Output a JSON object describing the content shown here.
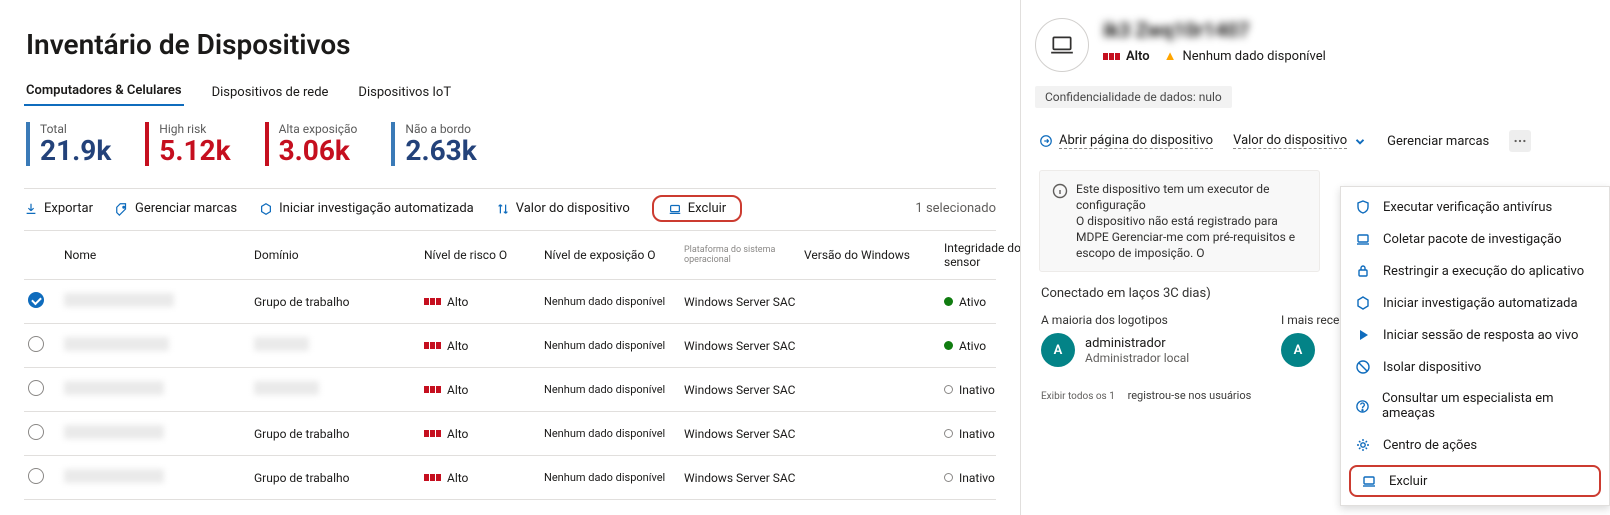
{
  "page": {
    "title": "Inventário de Dispositivos"
  },
  "tabs": [
    {
      "label": "Computadores &amp; Celulares",
      "selected": true
    },
    {
      "label": "Dispositivos de rede"
    },
    {
      "label": "Dispositivos IoT"
    }
  ],
  "stats": {
    "total": {
      "label": "Total",
      "value": "21.9k"
    },
    "high": {
      "label": "High risk",
      "value": "5.12k"
    },
    "exposure": {
      "label": "Alta exposição",
      "value": "3.06k"
    },
    "noboard": {
      "label": "Não a bordo",
      "value": "2.63k"
    }
  },
  "toolbar": {
    "export": "Exportar",
    "manage_tags": "Gerenciar marcas",
    "start_auto": "Iniciar investigação automatizada",
    "device_value": "Valor do dispositivo",
    "exclude": "Excluir",
    "selected": "1 selecionado"
  },
  "columns": {
    "name": "Nome",
    "domain": "Domínio",
    "risk": "Nível de risco O",
    "exposure": "Nível de exposição O",
    "platform": "Plataforma do sistema operacional",
    "winver": "Versão do Windows",
    "sensor": "Integridade do sensor"
  },
  "risk_label": "Alto",
  "exposure_label": "Nenhum dado disponível",
  "rows": [
    {
      "selected": true,
      "name_blur": 110,
      "domain": "Grupo de trabalho",
      "platform": "Windows Server SAC",
      "sensor": "Ativo",
      "active": true
    },
    {
      "selected": false,
      "name_blur": 105,
      "domain_blur": 55,
      "platform": "Windows Server SAC",
      "sensor": "Ativo",
      "active": true
    },
    {
      "selected": false,
      "name_blur": 100,
      "domain_blur": 65,
      "platform": "Windows Server SAC",
      "sensor": "Inativo",
      "active": false
    },
    {
      "selected": false,
      "name_blur": 100,
      "domain": "Grupo de trabalho",
      "platform": "Windows Server SAC",
      "sensor": "Inativo",
      "active": false
    },
    {
      "selected": false,
      "name_blur": 100,
      "domain": "Grupo de trabalho",
      "platform": "Windows Server SAC",
      "sensor": "Inativo",
      "active": false
    }
  ],
  "panel": {
    "name_blur": "ik3  Zwq10r1407",
    "severity": "Alto",
    "warning": "Nenhum dado disponível",
    "data_class": "Confidencialidade de dados: nulo",
    "links": {
      "open_page": "Abrir página do dispositivo",
      "value": "Valor do dispositivo",
      "manage_tags": "Gerenciar marcas"
    },
    "info1": "Este dispositivo tem um executor de configuração",
    "info2": "O dispositivo não está registrado para MDPE Gerenciar-me com pré-requisitos e escopo de imposição. O",
    "connected": "Conectado em laços 3C dias)",
    "col_most": "A maioria dos logotipos",
    "col_recent": "I mais recente",
    "admin_role": "administrador",
    "admin_sub": "Administrador local",
    "avatar_initial": "A",
    "foot_small": "Exibir todos os 1",
    "foot": "registrou-se nos usuários"
  },
  "menu": {
    "items": [
      {
        "key": "scan",
        "label": "Executar verificação antivírus",
        "icon": "shield"
      },
      {
        "key": "collect",
        "label": "Coletar pacote de investigação",
        "icon": "laptop"
      },
      {
        "key": "restrict",
        "label": "Restringir a execução do aplicativo",
        "icon": "lock"
      },
      {
        "key": "auto",
        "label": "Iniciar investigação automatizada",
        "icon": "hex"
      },
      {
        "key": "live",
        "label": "Iniciar sessão de resposta ao vivo",
        "icon": "play"
      },
      {
        "key": "isolate",
        "label": "Isolar dispositivo",
        "icon": "stop"
      },
      {
        "key": "expert",
        "label": "Consultar um especialista em ameaças",
        "icon": "help"
      },
      {
        "key": "actions",
        "label": "Centro de ações",
        "icon": "gear"
      },
      {
        "key": "exclude",
        "label": "Excluir",
        "icon": "laptop",
        "highlight": true
      }
    ]
  }
}
